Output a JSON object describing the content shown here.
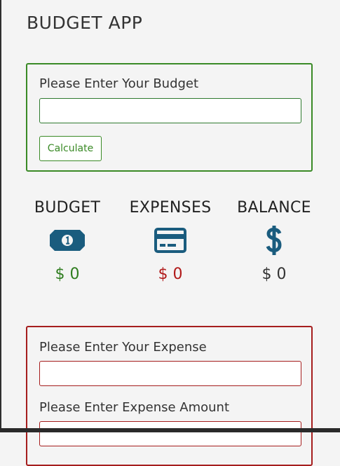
{
  "app": {
    "title": "BUDGET APP"
  },
  "budget_form": {
    "label": "Please Enter Your Budget",
    "input_value": "",
    "button_label": "Calculate"
  },
  "summary": {
    "budget": {
      "title": "BUDGET",
      "icon": "money-bill-icon",
      "amount": "$ 0",
      "color": "#2f7d1f"
    },
    "expenses": {
      "title": "EXPENSES",
      "icon": "credit-card-icon",
      "amount": "$ 0",
      "color": "#b11a1a"
    },
    "balance": {
      "title": "BALANCE",
      "icon": "dollar-sign-icon",
      "amount": "$ 0",
      "color": "#333333"
    },
    "icon_color": "#1a5c7e"
  },
  "expense_form": {
    "expense_label": "Please Enter Your Expense",
    "expense_value": "",
    "amount_label": "Please Enter Expense Amount",
    "amount_value": ""
  },
  "colors": {
    "budget_border": "#3a8a26",
    "expense_border": "#a51d1d",
    "background": "#f4f4f4"
  }
}
